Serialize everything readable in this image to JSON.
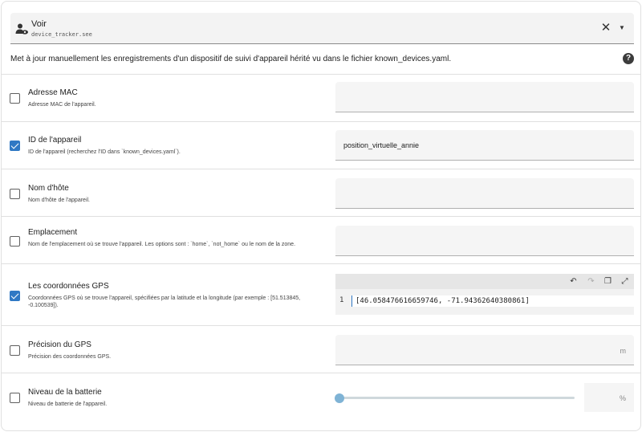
{
  "service": {
    "name": "Voir",
    "id": "device_tracker.see",
    "clear_icon": "close-icon",
    "dropdown_icon": "chevron-down-icon"
  },
  "description": "Met à jour manuellement les enregistrements d'un dispositif de suivi d'appareil hérité vu dans le fichier known_devices.yaml.",
  "help_icon": "?",
  "fields": {
    "mac": {
      "label": "Adresse MAC",
      "hint": "Adresse MAC de l'appareil.",
      "checked": false,
      "value": ""
    },
    "dev_id": {
      "label": "ID de l'appareil",
      "hint": "ID de l'appareil (recherchez l'ID dans `known_devices.yaml`).",
      "checked": true,
      "value": "position_virtuelle_annie"
    },
    "host_name": {
      "label": "Nom d'hôte",
      "hint": "Nom d'hôte de l'appareil.",
      "checked": false,
      "value": ""
    },
    "location_name": {
      "label": "Emplacement",
      "hint": "Nom de l'emplacement où se trouve l'appareil. Les options sont : `home`, `not_home` ou le nom de la zone.",
      "checked": false,
      "value": ""
    },
    "gps": {
      "label": "Les coordonnées GPS",
      "hint": "Coordonnées GPS où se trouve l'appareil, spécifiées par la latitude et la longitude (par exemple : [51.513845, -0.100539]).",
      "checked": true,
      "line_number": "1",
      "code": "[46.058476616659746, -71.94362640380861]"
    },
    "gps_accuracy": {
      "label": "Précision du GPS",
      "hint": "Précision des coordonnées GPS.",
      "checked": false,
      "unit": "m"
    },
    "battery": {
      "label": "Niveau de la batterie",
      "hint": "Niveau de batterie de l'appareil.",
      "checked": false,
      "unit": "%",
      "slider_level": 0
    }
  },
  "editor_toolbar": {
    "undo_icon": "undo-icon",
    "redo_icon": "redo-icon",
    "copy_icon": "copy-icon",
    "fullscreen_icon": "fullscreen-icon"
  },
  "colors": {
    "accent": "#2f78c4",
    "slider_thumb": "#7fb3d5"
  }
}
